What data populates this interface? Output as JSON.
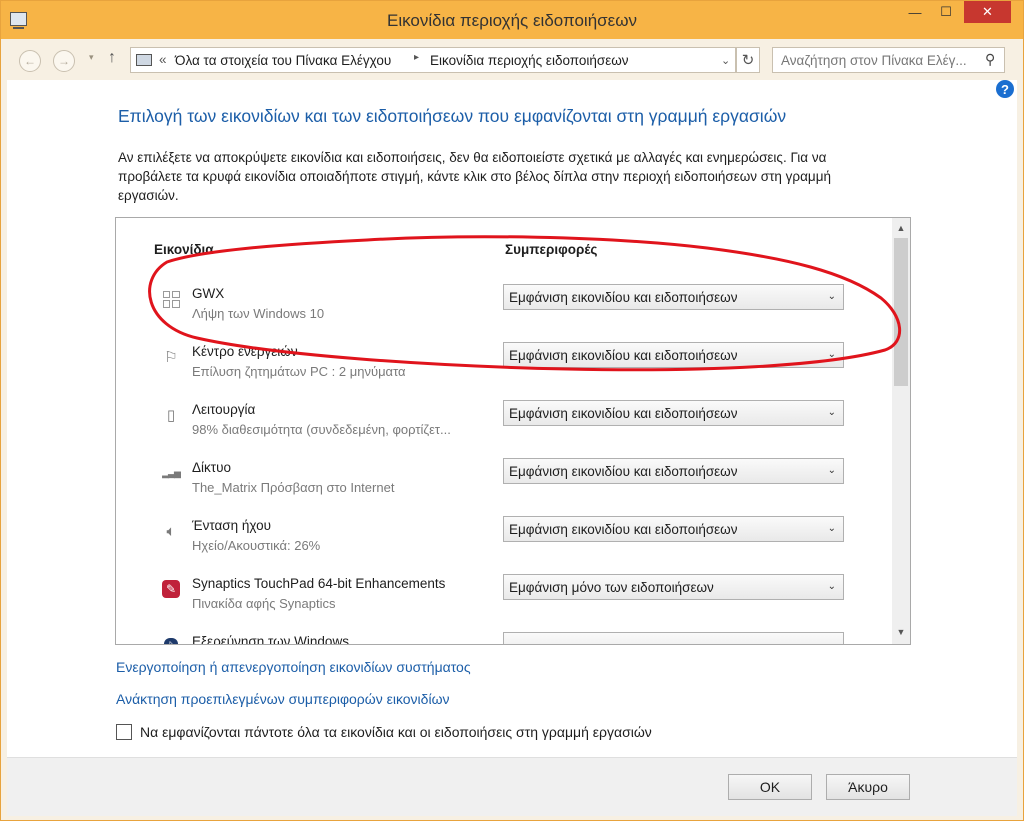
{
  "window": {
    "title": "Εικονίδια περιοχής ειδοποιήσεων",
    "minimize_glyph": "—",
    "maximize_glyph": "☐",
    "close_glyph": "✕"
  },
  "nav": {
    "back_glyph": "←",
    "forward_glyph": "→",
    "history_glyph": "▾",
    "up_glyph": "↑",
    "breadcrumb_prefix": "«",
    "breadcrumb_1": "Όλα τα στοιχεία του Πίνακα Ελέγχου",
    "breadcrumb_separator": "▸",
    "breadcrumb_2": "Εικονίδια περιοχής ειδοποιήσεων",
    "dropdown_glyph": "⌄",
    "refresh_glyph": "↻",
    "search_placeholder": "Αναζήτηση στον Πίνακα Ελέγ...",
    "search_icon_glyph": "⚲"
  },
  "help_glyph": "?",
  "heading": "Επιλογή των εικονιδίων και των ειδοποιήσεων που εμφανίζονται στη γραμμή εργασιών",
  "description": "Αν επιλέξετε να αποκρύψετε εικονίδια και ειδοποιήσεις, δεν θα ειδοποιείστε σχετικά με αλλαγές και ενημερώσεις. Για να προβάλετε τα κρυφά εικονίδια οποιαδήποτε στιγμή, κάντε κλικ στο βέλος δίπλα στην περιοχή ειδοποιήσεων στη γραμμή εργασιών.",
  "list": {
    "col_icons": "Εικονίδια",
    "col_behaviors": "Συμπεριφορές",
    "rows": [
      {
        "name": "GWX",
        "sub": "Λήψη των Windows 10",
        "behavior": "Εμφάνιση εικονιδίου και ειδοποιήσεων",
        "icon": "windows-logo-icon"
      },
      {
        "name": "Κέντρο ενεργειών",
        "sub": "Επίλυση ζητημάτων PC : 2 μηνύματα",
        "behavior": "Εμφάνιση εικονιδίου και ειδοποιήσεων",
        "icon": "flag-icon",
        "icon_glyph": "⚐"
      },
      {
        "name": "Λειτουργία",
        "sub": "98% διαθεσιμότητα (συνδεδεμένη, φορτίζετ...",
        "behavior": "Εμφάνιση εικονιδίου και ειδοποιήσεων",
        "icon": "battery-plug-icon",
        "icon_glyph": "▯"
      },
      {
        "name": "Δίκτυο",
        "sub": "The_Matrix Πρόσβαση στο Internet",
        "behavior": "Εμφάνιση εικονιδίου και ειδοποιήσεων",
        "icon": "signal-bars-icon",
        "icon_glyph": "▂▃▅"
      },
      {
        "name": "Ένταση ήχου",
        "sub": "Ηχείο/Ακουστικά: 26%",
        "behavior": "Εμφάνιση εικονιδίου και ειδοποιήσεων",
        "icon": "speaker-icon",
        "icon_glyph": "🔈︎"
      },
      {
        "name": "Synaptics TouchPad 64-bit Enhancements",
        "sub": "Πινακίδα αφής Synaptics",
        "behavior": "Εμφάνιση μόνο των ειδοποιήσεων",
        "icon": "synaptics-icon",
        "icon_glyph": "✎"
      },
      {
        "name": "Εξερεύνηση των Windows",
        "sub": "",
        "behavior": "",
        "icon": "bluetooth-icon",
        "icon_glyph": "ᛒ"
      }
    ],
    "dropdown_chevron": "⌄",
    "scroll_up_glyph": "▲",
    "scroll_down_glyph": "▼"
  },
  "links": {
    "system_icons": "Ενεργοποίηση ή απενεργοποίηση εικονιδίων συστήματος",
    "restore_defaults": "Ανάκτηση προεπιλεγμένων συμπεριφορών εικονιδίων"
  },
  "always_show": {
    "label": "Να εμφανίζονται πάντοτε όλα τα εικονίδια και οι ειδοποιήσεις στη γραμμή εργασιών",
    "checked": false
  },
  "buttons": {
    "ok": "OK",
    "cancel": "Άκυρο"
  },
  "colors": {
    "titlebar": "#f7b446",
    "close_button": "#c7372f",
    "heading_blue": "#1c5ea8",
    "annotation_red": "#e0141c"
  }
}
